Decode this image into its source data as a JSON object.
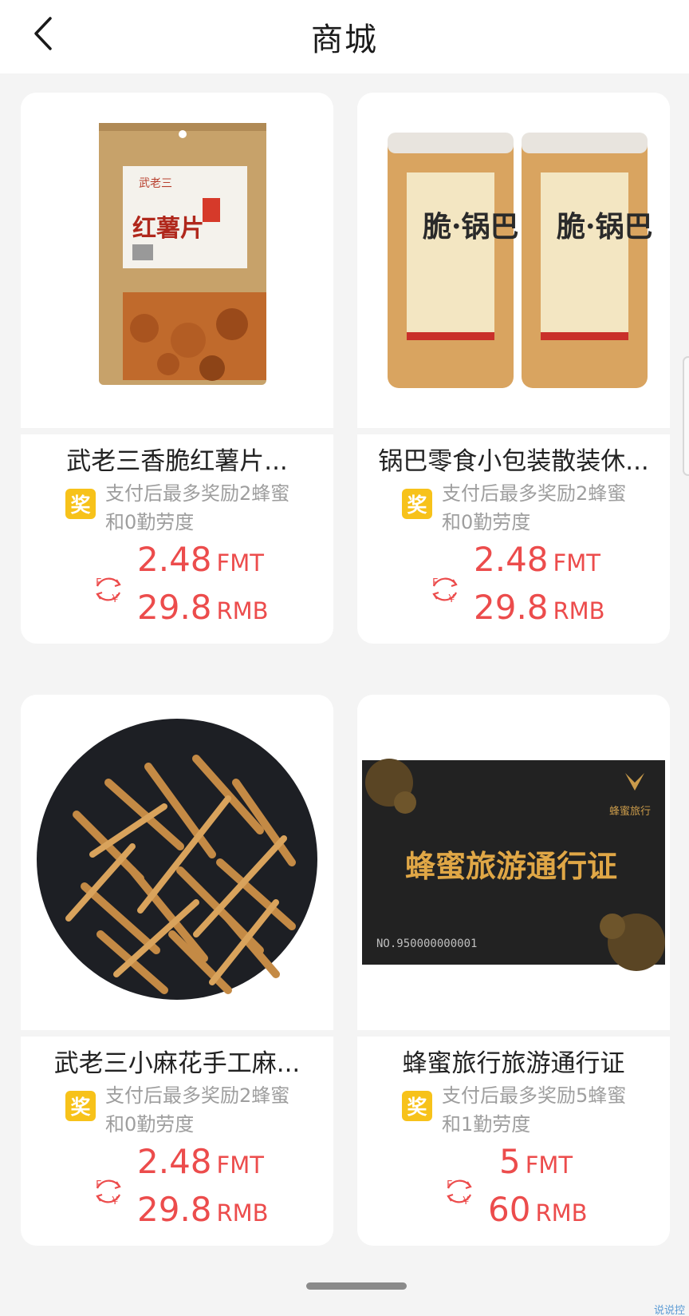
{
  "header": {
    "title": "商城"
  },
  "products": [
    {
      "name": "武老三香脆红薯片...",
      "reward_line1": "支付后最多奖励2蜂蜜",
      "reward_line2": "和0勤劳度",
      "badge": "奖",
      "fmt_price": "2.48",
      "fmt_unit": "FMT",
      "rmb_price": "29.8",
      "rmb_unit": "RMB",
      "image": {
        "label": "红薯片",
        "brand": "武老三"
      }
    },
    {
      "name": "锅巴零食小包装散装休...",
      "reward_line1": "支付后最多奖励2蜂蜜",
      "reward_line2": "和0勤劳度",
      "badge": "奖",
      "fmt_price": "2.48",
      "fmt_unit": "FMT",
      "rmb_price": "29.8",
      "rmb_unit": "RMB",
      "image": {
        "label": "脆·锅巴"
      }
    },
    {
      "name": "武老三小麻花手工麻...",
      "reward_line1": "支付后最多奖励2蜂蜜",
      "reward_line2": "和0勤劳度",
      "badge": "奖",
      "fmt_price": "2.48",
      "fmt_unit": "FMT",
      "rmb_price": "29.8",
      "rmb_unit": "RMB"
    },
    {
      "name": "蜂蜜旅行旅游通行证",
      "reward_line1": "支付后最多奖励5蜂蜜",
      "reward_line2": "和1勤劳度",
      "badge": "奖",
      "fmt_price": "5",
      "fmt_unit": "FMT",
      "rmb_price": "60",
      "rmb_unit": "RMB",
      "image": {
        "title": "蜂蜜旅游通行证",
        "brand": "蜂蜜旅行",
        "serial": "NO.950000000001"
      }
    }
  ],
  "icons": {
    "back": "chevron-left-icon",
    "currency_swap": "currency-swap-icon",
    "reward": "reward-badge"
  },
  "colors": {
    "price": "#ec4c4c",
    "badge": "#f7c21a",
    "muted": "#9e9e9e"
  },
  "watermark": "说说控"
}
